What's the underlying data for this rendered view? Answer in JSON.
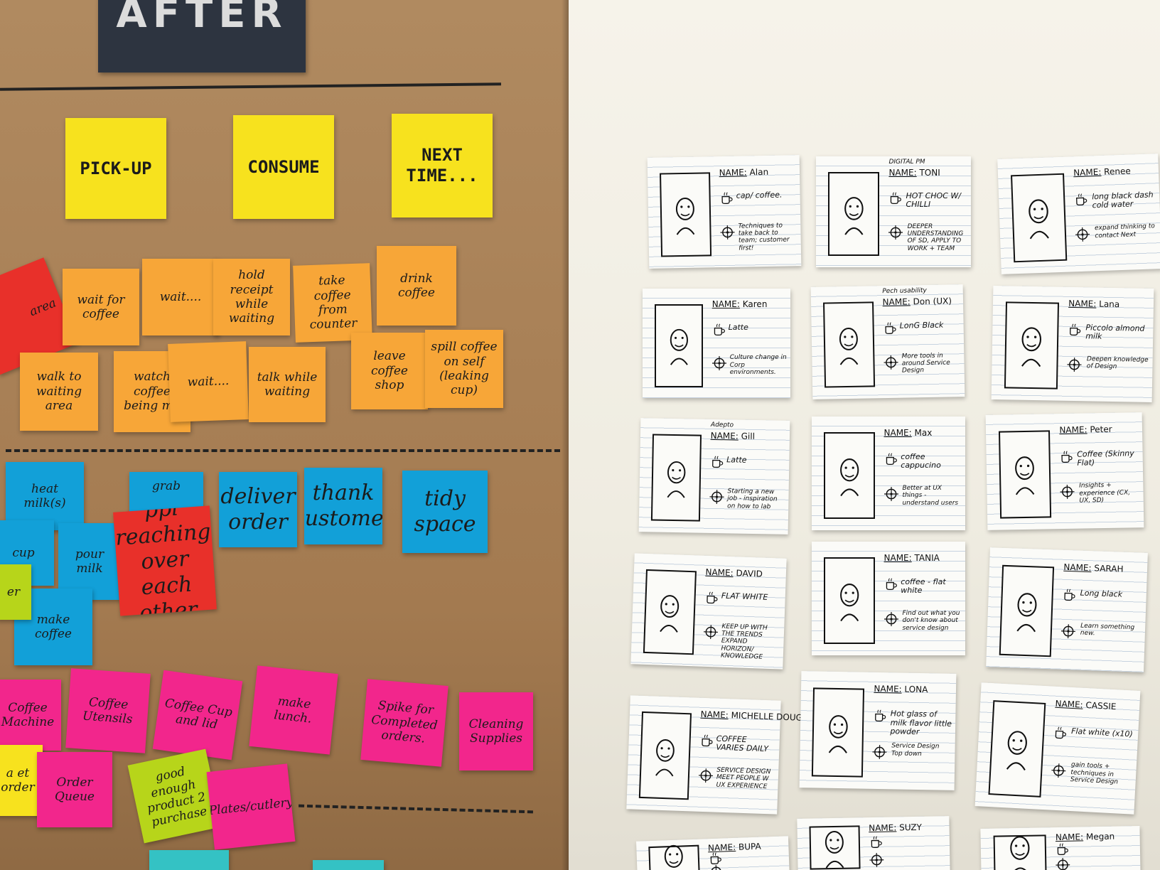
{
  "sign": {
    "label": "AFTER"
  },
  "yellow_notes": [
    {
      "id": "pickup",
      "text": "PICK-UP"
    },
    {
      "id": "consume",
      "text": "CONSUME"
    },
    {
      "id": "next",
      "text": "NEXT TIME..."
    }
  ],
  "orange_notes": [
    "wait for coffee",
    "wait....",
    "hold receipt while waiting",
    "take coffee from counter",
    "drink coffee",
    "walk to waiting area",
    "watch coffee being ma",
    "wait....",
    "talk while waiting",
    "leave coffee shop",
    "spill coffee on self (leaking cup)"
  ],
  "red_notes": [
    "area",
    "ppl reaching over each other"
  ],
  "blue_notes": [
    "heat milk(s)",
    "grab",
    "deliver order",
    "thank customer",
    "tidy space",
    "cup",
    "pour milk",
    "make coffee"
  ],
  "green_notes": [
    "er",
    "good enough product 2 purchase"
  ],
  "pink_notes": [
    "Coffee Machine",
    "Coffee Utensils",
    "Coffee Cup and lid",
    "make lunch.",
    "Spike for Completed orders.",
    "Cleaning Supplies",
    "Order Queue",
    "Plates/cutlery"
  ],
  "yellow_small": [
    "a et order"
  ],
  "cards": [
    {
      "name": "Alan",
      "coffee": "cap/ coffee.",
      "goal": "Techniques to take back to team; customer first!"
    },
    {
      "name": "TONI",
      "extra": "DIGITAL PM",
      "coffee": "HOT CHOC W/ CHILLI",
      "goal": "DEEPER UNDERSTANDING OF SD, APPLY TO WORK + TEAM"
    },
    {
      "name": "Renee",
      "coffee": "long black dash cold water",
      "goal": "expand thinking to contact Next"
    },
    {
      "name": "Karen",
      "coffee": "Latte",
      "goal": "Culture change in Corp environments."
    },
    {
      "name": "Don (UX)",
      "extra": "Pech usability",
      "coffee": "LonG Black",
      "goal": "More tools in around Service Design"
    },
    {
      "name": "Lana",
      "coffee": "Piccolo almond milk",
      "goal": "Deepen knowledge of Design"
    },
    {
      "name": "Gill",
      "extra": "Adepto",
      "coffee": "Latte",
      "goal": "Starting a new job - inspiration on how to lab"
    },
    {
      "name": "Max",
      "coffee": "coffee cappucino",
      "goal": "Better at UX things - understand users"
    },
    {
      "name": "Peter",
      "coffee": "Coffee (Skinny Flat)",
      "goal": "Insights + experience (CX, UX, SD)"
    },
    {
      "name": "DAVID",
      "coffee": "FLAT WHITE",
      "goal": "KEEP UP WITH THE TRENDS EXPAND HORIZON/ KNOWLEDGE"
    },
    {
      "name": "TANIA",
      "coffee": "coffee - flat white",
      "goal": "Find out what you don't know about service design"
    },
    {
      "name": "SARAH",
      "coffee": "Long black",
      "goal": "Learn something new."
    },
    {
      "name": "MICHELLE DOUGLAS",
      "coffee": "COFFEE VARIES DAILY",
      "goal": "SERVICE DESIGN MEET PEOPLE W UX EXPERIENCE"
    },
    {
      "name": "LONA",
      "coffee": "Hot glass of milk flavor little powder",
      "goal": "Service Design Top down"
    },
    {
      "name": "CASSIE",
      "coffee": "Flat white (x10)",
      "goal": "gain tools + techniques in Service Design"
    },
    {
      "name": "BUPA",
      "coffee": "",
      "goal": ""
    },
    {
      "name": "SUZY",
      "coffee": "",
      "goal": ""
    },
    {
      "name": "Megan",
      "coffee": "",
      "goal": ""
    }
  ],
  "card_labels": {
    "name_prefix": "NAME:",
    "cup_icon": "coffee-cup-icon",
    "target_icon": "target-icon"
  },
  "colors": {
    "kraft": "#a98157",
    "yellow": "#f7e21e",
    "orange": "#f7a638",
    "red": "#e8302a",
    "blue": "#12a0d8",
    "pink": "#f2268c",
    "lime": "#b7d51a",
    "sign": "#2d3440"
  }
}
